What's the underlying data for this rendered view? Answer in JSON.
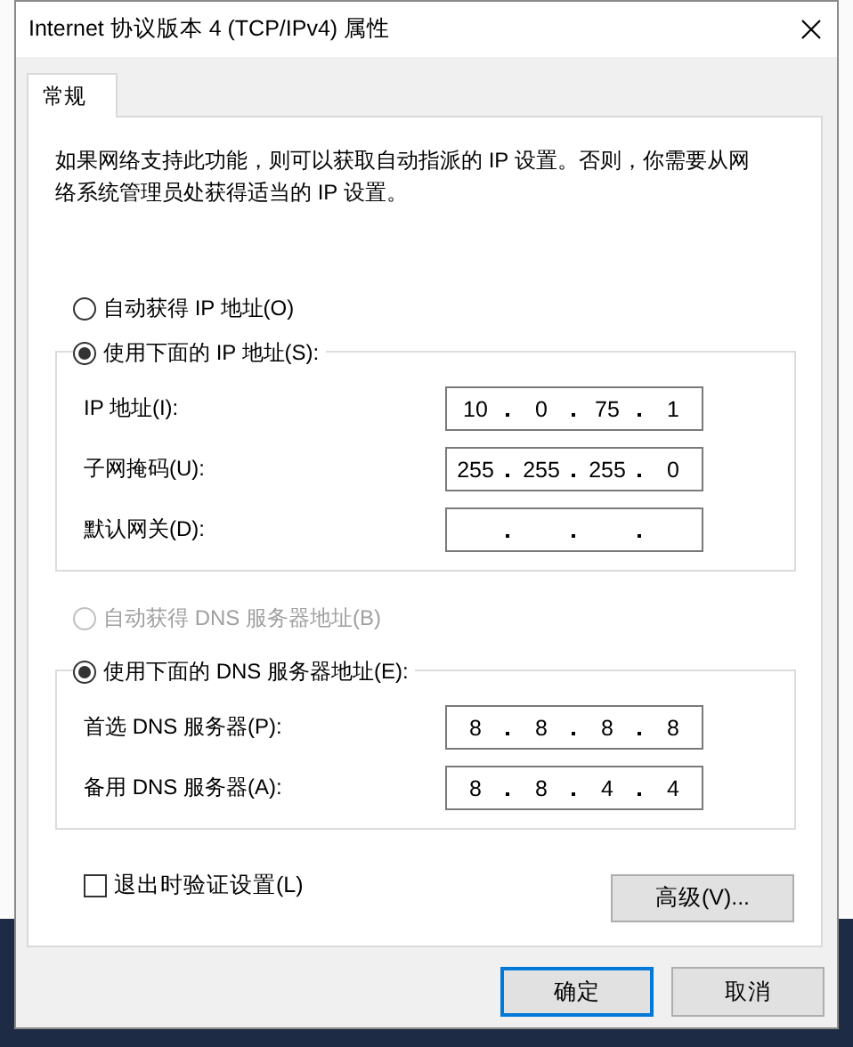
{
  "window": {
    "title": "Internet 协议版本 4 (TCP/IPv4) 属性"
  },
  "tabs": [
    {
      "label": "常规",
      "selected": true
    }
  ],
  "description": "如果网络支持此功能，则可以获取自动指派的 IP 设置。否则，你需要从网络系统管理员处获得适当的 IP 设置。",
  "ip_section": {
    "options": [
      {
        "label": "自动获得 IP 地址(O)",
        "selected": false,
        "disabled": false
      },
      {
        "label": "使用下面的 IP 地址(S):",
        "selected": true,
        "disabled": false
      }
    ],
    "fields": [
      {
        "label": "IP 地址(I):",
        "octets": [
          "10",
          "0",
          "75",
          "1"
        ]
      },
      {
        "label": "子网掩码(U):",
        "octets": [
          "255",
          "255",
          "255",
          "0"
        ]
      },
      {
        "label": "默认网关(D):"
      }
    ]
  },
  "dns_section": {
    "options": [
      {
        "label": "自动获得 DNS 服务器地址(B)",
        "selected": false,
        "disabled": true
      },
      {
        "label": "使用下面的 DNS 服务器地址(E):",
        "selected": true,
        "disabled": false
      }
    ],
    "fields": [
      {
        "label": "首选 DNS 服务器(P):",
        "octets": [
          "8",
          "8",
          "8",
          "8"
        ]
      },
      {
        "label": "备用 DNS 服务器(A):",
        "octets": [
          "8",
          "8",
          "4",
          "4"
        ]
      }
    ]
  },
  "validate_checkbox": {
    "label": "退出时验证设置(L)",
    "checked": false
  },
  "advanced_button": "高级(V)...",
  "buttons": [
    {
      "label": "确定",
      "default": true
    },
    {
      "label": "取消",
      "default": false
    }
  ]
}
